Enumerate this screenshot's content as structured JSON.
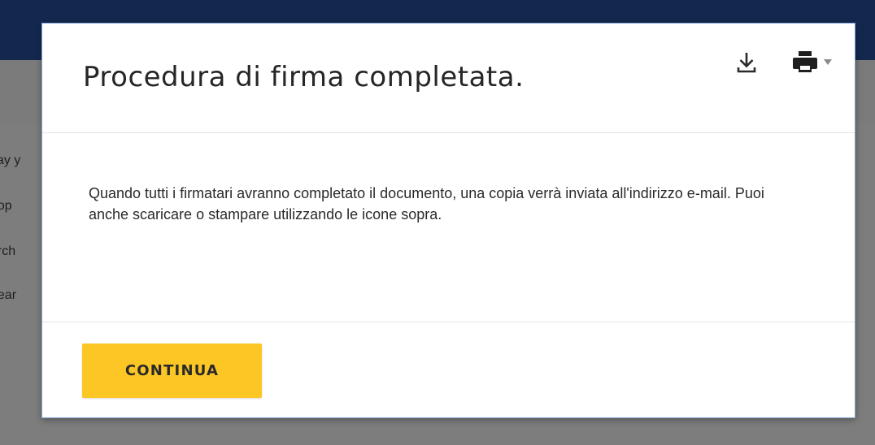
{
  "background": {
    "lines": [
      "vay y",
      "eop",
      "arch",
      "hear"
    ]
  },
  "dialog": {
    "title": "Procedura di firma completata.",
    "message": "Quando tutti i firmatari avranno completato il documento, una copia verrà inviata all'indirizzo e-mail. Puoi anche scaricare o stampare utilizzando le icone sopra.",
    "continue_label": "CONTINUA",
    "icons": {
      "download": "download-icon",
      "print": "print-icon",
      "dropdown": "caret-down-icon"
    }
  },
  "colors": {
    "topbar": "#14284f",
    "overlay": "#7d7d7d",
    "button": "#fcc625",
    "modal_border": "#7fa2d6"
  }
}
